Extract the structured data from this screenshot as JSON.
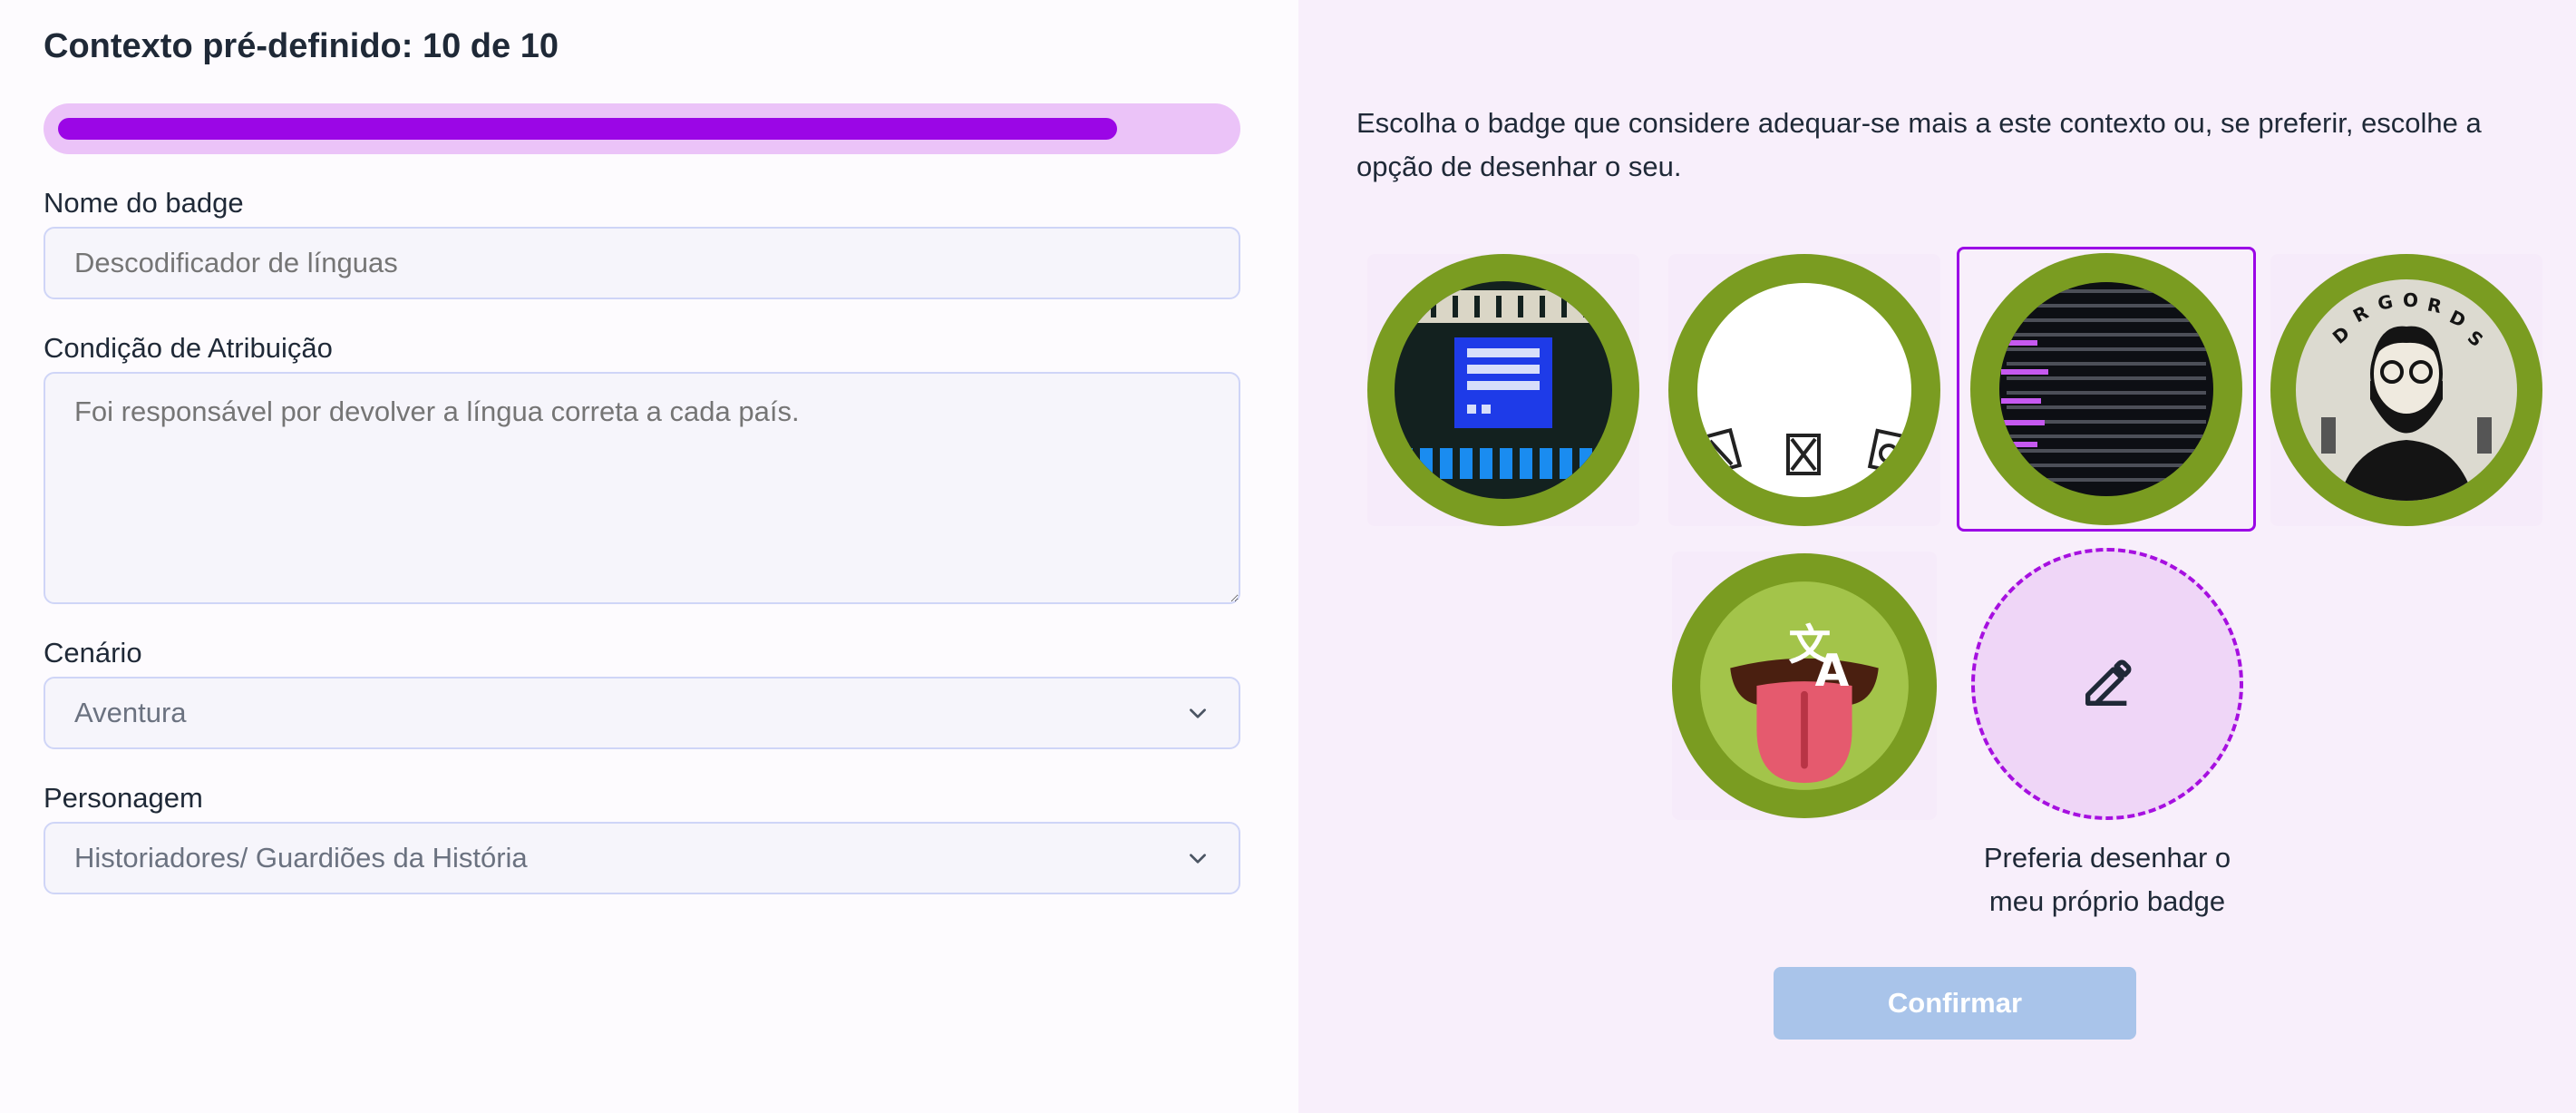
{
  "header": {
    "title": "Contexto pré-definido: 10 de 10"
  },
  "progress": {
    "value": 10,
    "max": 10,
    "percent": 100
  },
  "form": {
    "name_label": "Nome do badge",
    "name_placeholder": "Descodificador de línguas",
    "condition_label": "Condição de Atribuição",
    "condition_placeholder": "Foi responsável por devolver a língua correta a cada país.",
    "scenario_label": "Cenário",
    "scenario_value": "Aventura",
    "character_label": "Personagem",
    "character_value": "Historiadores/ Guardiões da História"
  },
  "badges": {
    "instruction": "Escolha o badge que considere adequar-se mais a este contexto ou, se preferir, escolhe a opção de desenhar o seu.",
    "items": [
      {
        "icon": "pixel-computer-badge",
        "selected": false
      },
      {
        "icon": "symbols-badge",
        "selected": false
      },
      {
        "icon": "binary-code-badge",
        "selected": true
      },
      {
        "icon": "bearded-man-badge",
        "selected": false
      },
      {
        "icon": "translate-tongue-badge",
        "selected": false
      }
    ],
    "draw_option_label_line1": "Preferia desenhar o",
    "draw_option_label_line2": "meu próprio badge",
    "draw_icon": "edit-icon"
  },
  "actions": {
    "confirm_label": "Confirmar"
  },
  "colors": {
    "accent": "#9b06e6",
    "badge_ring": "#7a9c21",
    "confirm_disabled": "#a9c4ea",
    "right_panel_bg": "#f8effb"
  }
}
